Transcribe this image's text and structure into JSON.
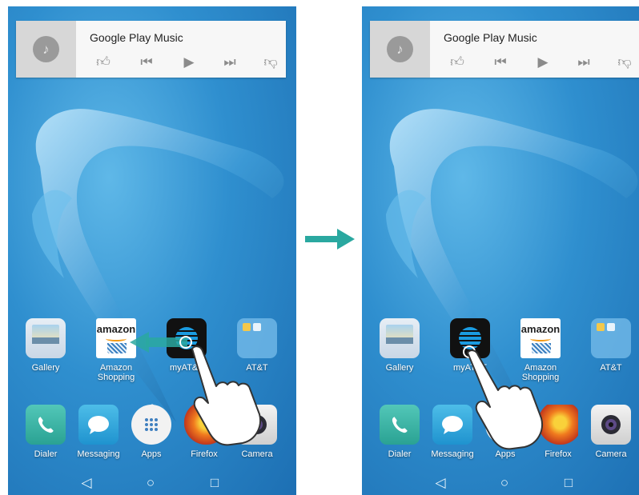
{
  "music_widget": {
    "title": "Google Play Music"
  },
  "apps_row": {
    "before": [
      "Gallery",
      "Amazon\nShopping",
      "myAT&T",
      "AT&T"
    ],
    "after": [
      "Gallery",
      "myAT&T",
      "Amazon\nShopping",
      "AT&T"
    ]
  },
  "dock": [
    "Dialer",
    "Messaging",
    "Apps",
    "Firefox",
    "Camera"
  ],
  "icon_labels": {
    "amazon_word": "amazon"
  },
  "colors": {
    "accent_arrow": "#2aa8a0",
    "wallpaper": "#2f8fcf"
  }
}
